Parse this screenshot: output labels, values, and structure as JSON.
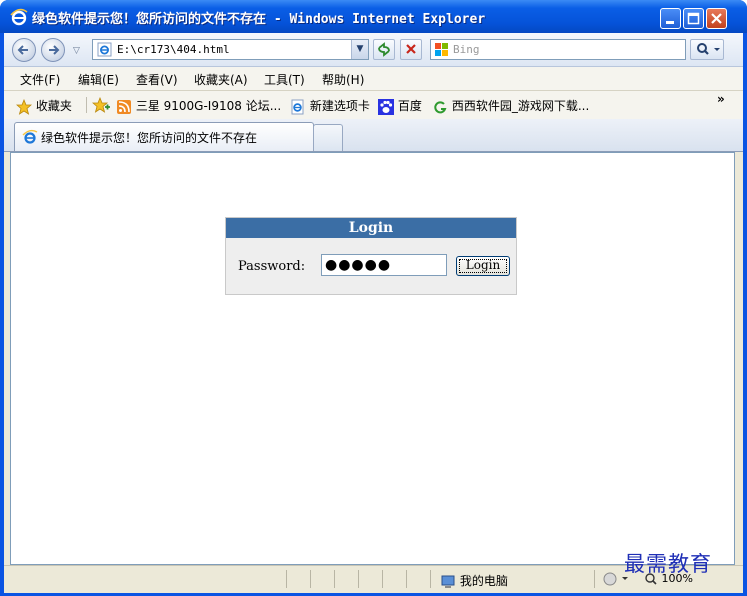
{
  "window": {
    "title": "绿色软件提示您！您所访问的文件不存在 - Windows Internet Explorer"
  },
  "address": {
    "url": "E:\\cr173\\404.html"
  },
  "search": {
    "placeholder": "Bing"
  },
  "menu": {
    "items": [
      "文件(F)",
      "编辑(E)",
      "查看(V)",
      "收藏夹(A)",
      "工具(T)",
      "帮助(H)"
    ]
  },
  "favorites": {
    "label": "收藏夹",
    "items": [
      "三星 9100G-I9108 论坛...",
      "新建选项卡",
      "百度",
      "西西软件园_游戏网下载..."
    ],
    "overflow": "»"
  },
  "tab": {
    "active_title": "绿色软件提示您！您所访问的文件不存在"
  },
  "login": {
    "header": "Login",
    "password_label": "Password:",
    "password_value": "●●●●●",
    "button_label": "Login"
  },
  "status": {
    "zone": "我的电脑",
    "zoom": "100%"
  },
  "watermark": {
    "text": "最需教育"
  },
  "colors": {
    "title_blue": "#0a5ee6",
    "login_header": "#3b6ea5"
  }
}
